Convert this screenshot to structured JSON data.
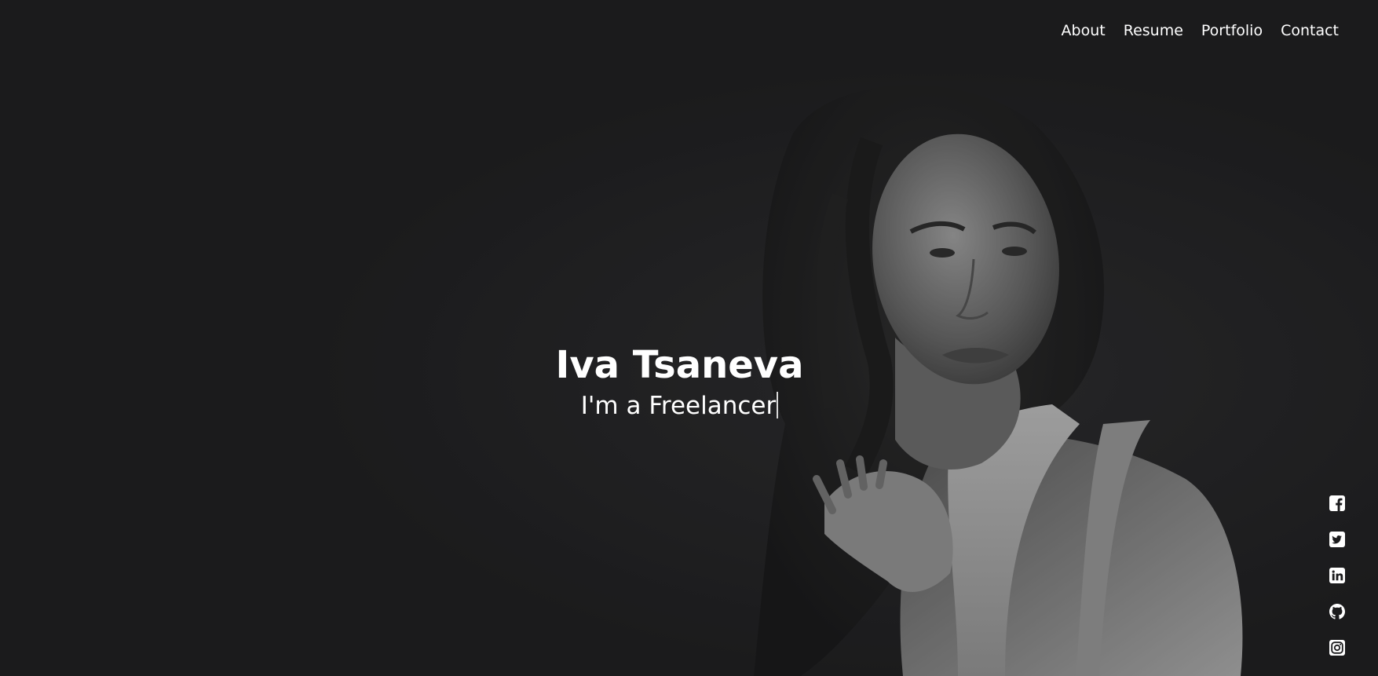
{
  "nav": {
    "items": [
      {
        "label": "About"
      },
      {
        "label": "Resume"
      },
      {
        "label": "Portfolio"
      },
      {
        "label": "Contact"
      }
    ]
  },
  "hero": {
    "name": "Iva Tsaneva",
    "tagline": "I'm a Freelancer"
  },
  "social": [
    {
      "icon": "facebook-icon"
    },
    {
      "icon": "twitter-icon"
    },
    {
      "icon": "linkedin-icon"
    },
    {
      "icon": "github-icon"
    },
    {
      "icon": "instagram-icon"
    }
  ],
  "colors": {
    "background": "#1b1b1d",
    "text": "#ffffff"
  }
}
